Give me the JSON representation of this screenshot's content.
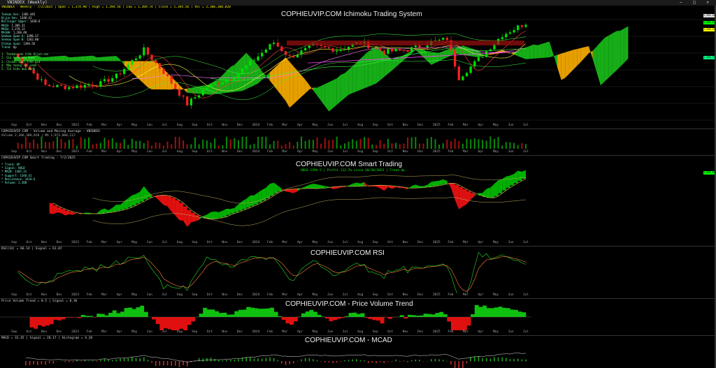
{
  "window": {
    "title": "VNINDEX (Weekly)",
    "controls": "– □ ×"
  },
  "price_pane": {
    "title": "COPHIEUVIP.COM Ichimoku Trading System",
    "header": "VNINDEX - Weekly - 7/2/2025 | Open = 1,374.90 | High = 1,394.56 | Low = 1,369.74 | Close = 1,394.56 | Vol = 2,306,380,820",
    "info": [
      {
        "k": "Tenkan-Sen:",
        "v": "1385.445"
      },
      {
        "k": "Kijun-Sen:",
        "v": "1348.41"
      },
      {
        "k": "Bollinger Upper:",
        "v": "1418.6"
      },
      {
        "k": "MA20:",
        "v": "1,305.31"
      },
      {
        "k": "MA50:",
        "v": "1,278.12"
      },
      {
        "k": "MA100:",
        "v": "1,266.48"
      },
      {
        "k": "Senkou Span A:",
        "v": "1296.17"
      },
      {
        "k": "Senkou Span B:",
        "v": "1262.80"
      },
      {
        "k": "Chikou Span:",
        "v": "1394.56"
      },
      {
        "k": "Trend:",
        "v": "Up"
      }
    ],
    "signals": [
      "1. Tenkan-sen trên Kijun-sen",
      "2. Giá trên mây Kumo",
      "3. Chikou Span trên giá",
      "4. Mây tương lai xanh",
      "5. Tín hiệu mua mạnh"
    ]
  },
  "volume_pane": {
    "header": "COPHIEUVIP.COM - Volume and Moving Average - VNINDEX",
    "sub": "Volume 2,306,380,820 | MA 1,973,000,112"
  },
  "smart_pane": {
    "title": "COPHIEUVIP.COM Smart Trading",
    "header": "COPHIEUVIP.COM Smart Trading - 7/2/2025",
    "banner": "HOLD 1394.5 | Profit 112.7% since 10/30/2023 | Trend Up",
    "metrics": [
      "* Trend: UP",
      "* Signal: HOLD",
      "* MA20: 1305.31",
      "* Support: 1348.41",
      "* Resistance: 1418.6",
      "* Volume: 2.30B"
    ]
  },
  "rsi_pane": {
    "title": "COPHIEUVIP.COM RSI",
    "header": "RSI(14) = 66.14 | Signal = 61.07"
  },
  "pvt_pane": {
    "title": "COPHIEUVIP.COM - Price Volume Trend",
    "header": "Price Volume Trend = 0.5 | Signal = 0.36"
  },
  "macd_pane": {
    "title": "COPHIEUVIP.COM - MCAD",
    "header": "MACD = 32.45 | Signal = 28.17 | Histogram = 4.28"
  },
  "axis_labels": [
    "Sep",
    "Oct",
    "Nov",
    "Dec",
    "2023",
    "Feb",
    "Mar",
    "Apr",
    "May",
    "Jun",
    "Jul",
    "Aug",
    "Sep",
    "Oct",
    "Nov",
    "Dec",
    "2024",
    "Feb",
    "Mar",
    "Apr",
    "May",
    "Jun",
    "Jul",
    "Aug",
    "Sep",
    "Oct",
    "Nov",
    "Dec",
    "2025",
    "Feb",
    "Mar",
    "Apr",
    "May",
    "Jun",
    "Jul"
  ],
  "price_labels": [
    "1,394.56",
    "1,385.44",
    "1,348.41",
    "1,305.31"
  ],
  "colors": {
    "bull": "#00e000",
    "bear": "#ff2020",
    "cloud_bull": "#18c018",
    "cloud_bear": "#ffb000",
    "signal": "#ff8040"
  }
}
